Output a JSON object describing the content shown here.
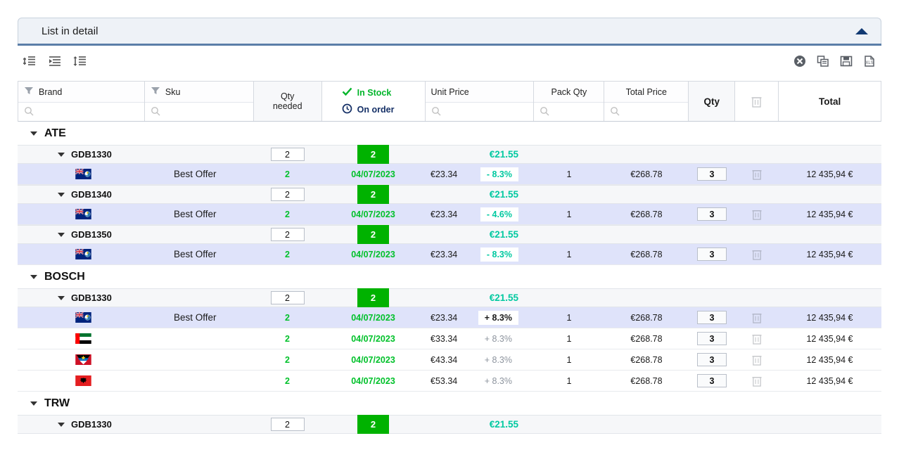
{
  "panel": {
    "title": "List in detail",
    "collapse_icon": "triangle-up-icon"
  },
  "toolbar": {
    "left_icons": [
      {
        "name": "expand-all-icon"
      },
      {
        "name": "indent-list-icon"
      },
      {
        "name": "collapse-all-icon"
      }
    ],
    "right_icons": [
      {
        "name": "cancel-circle-icon"
      },
      {
        "name": "copy-icon"
      },
      {
        "name": "save-icon"
      },
      {
        "name": "export-icon"
      }
    ]
  },
  "columns": {
    "brand": "Brand",
    "sku": "Sku",
    "qty_needed": "Qty\nneeded",
    "qty_needed_line1": "Qty",
    "qty_needed_line2": "needed",
    "in_stock": "In Stock",
    "on_order": "On order",
    "unit_price": "Unit Price",
    "pack_qty": "Pack Qty",
    "total_price": "Total Price",
    "qty": "Qty",
    "delete": "delete-column",
    "total": "Total"
  },
  "colors": {
    "in_stock_green": "#00b52a",
    "on_order_blue": "#142f66",
    "badge_green": "#00b200",
    "teal": "#00c9a0",
    "value_green": "#00c12a",
    "row_highlight": "#dfe3fa",
    "accent_underline": "#5b7ea8"
  },
  "groups": [
    {
      "name": "ATE",
      "skus": [
        {
          "code": "GDB1330",
          "qty_needed": "2",
          "in_stock": "2",
          "unit_price": "€21.55",
          "offers": [
            {
              "flag": "cayman-islands-flag",
              "label": "Best Offer",
              "qty": "2",
              "date": "04/07/2023",
              "unit_price": "€23.34",
              "discount": "- 8.3%",
              "discount_style": "green",
              "pack_qty": "1",
              "total_price": "€268.78",
              "order_qty": "3",
              "total": "12 435,94 €",
              "highlight": true
            }
          ]
        },
        {
          "code": "GDB1340",
          "qty_needed": "2",
          "in_stock": "2",
          "unit_price": "€21.55",
          "offers": [
            {
              "flag": "cayman-islands-flag",
              "label": "Best Offer",
              "qty": "2",
              "date": "04/07/2023",
              "unit_price": "€23.34",
              "discount": "- 4.6%",
              "discount_style": "green",
              "pack_qty": "1",
              "total_price": "€268.78",
              "order_qty": "3",
              "total": "12 435,94 €",
              "highlight": true
            }
          ]
        },
        {
          "code": "GDB1350",
          "qty_needed": "2",
          "in_stock": "2",
          "unit_price": "€21.55",
          "offers": [
            {
              "flag": "cayman-islands-flag",
              "label": "Best Offer",
              "qty": "2",
              "date": "04/07/2023",
              "unit_price": "€23.34",
              "discount": "- 8.3%",
              "discount_style": "green",
              "pack_qty": "1",
              "total_price": "€268.78",
              "order_qty": "3",
              "total": "12 435,94 €",
              "highlight": true
            }
          ]
        }
      ]
    },
    {
      "name": "BOSCH",
      "skus": [
        {
          "code": "GDB1330",
          "qty_needed": "2",
          "in_stock": "2",
          "unit_price": "€21.55",
          "offers": [
            {
              "flag": "cayman-islands-flag",
              "label": "Best Offer",
              "qty": "2",
              "date": "04/07/2023",
              "unit_price": "€23.34",
              "discount": "+ 8.3%",
              "discount_style": "dark",
              "pack_qty": "1",
              "total_price": "€268.78",
              "order_qty": "3",
              "total": "12 435,94 €",
              "highlight": true
            },
            {
              "flag": "united-arab-emirates-flag",
              "label": "",
              "qty": "2",
              "date": "04/07/2023",
              "unit_price": "€33.34",
              "discount": "+ 8.3%",
              "discount_style": "gray",
              "pack_qty": "1",
              "total_price": "€268.78",
              "order_qty": "3",
              "total": "12 435,94 €",
              "highlight": false
            },
            {
              "flag": "antigua-and-barbuda-flag",
              "label": "",
              "qty": "2",
              "date": "04/07/2023",
              "unit_price": "€43.34",
              "discount": "+ 8.3%",
              "discount_style": "gray",
              "pack_qty": "1",
              "total_price": "€268.78",
              "order_qty": "3",
              "total": "12 435,94 €",
              "highlight": false
            },
            {
              "flag": "albania-flag",
              "label": "",
              "qty": "2",
              "date": "04/07/2023",
              "unit_price": "€53.34",
              "discount": "+ 8.3%",
              "discount_style": "gray",
              "pack_qty": "1",
              "total_price": "€268.78",
              "order_qty": "3",
              "total": "12 435,94 €",
              "highlight": false
            }
          ]
        }
      ]
    },
    {
      "name": "TRW",
      "skus": [
        {
          "code": "GDB1330",
          "qty_needed": "2",
          "in_stock": "2",
          "unit_price": "€21.55",
          "offers": []
        }
      ]
    }
  ]
}
